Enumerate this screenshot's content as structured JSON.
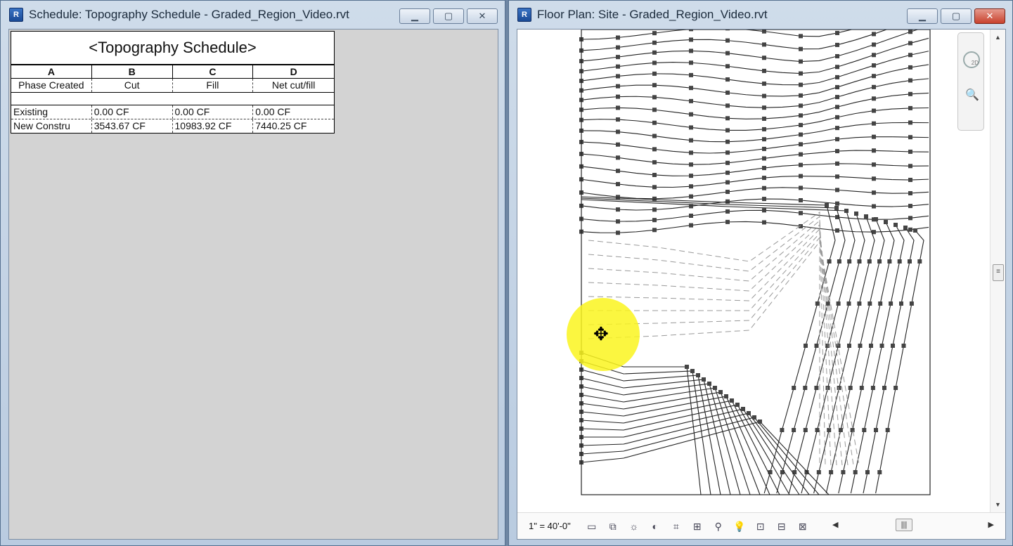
{
  "schedule_window": {
    "title": "Schedule: Topography Schedule - Graded_Region_Video.rvt",
    "table": {
      "title": "<Topography Schedule>",
      "column_letters": [
        "A",
        "B",
        "C",
        "D"
      ],
      "column_headers": [
        "Phase Created",
        "Cut",
        "Fill",
        "Net cut/fill"
      ],
      "rows": [
        [
          "Existing",
          "0.00 CF",
          "0.00 CF",
          "0.00 CF"
        ],
        [
          "New Constru",
          "3543.67 CF",
          "10983.92 CF",
          "7440.25 CF"
        ]
      ]
    }
  },
  "plan_window": {
    "title": "Floor Plan: Site - Graded_Region_Video.rvt",
    "scale": "1\" = 40'-0\""
  },
  "colors": {
    "highlight": "#f7f21a",
    "close_button": "#c8412d"
  }
}
